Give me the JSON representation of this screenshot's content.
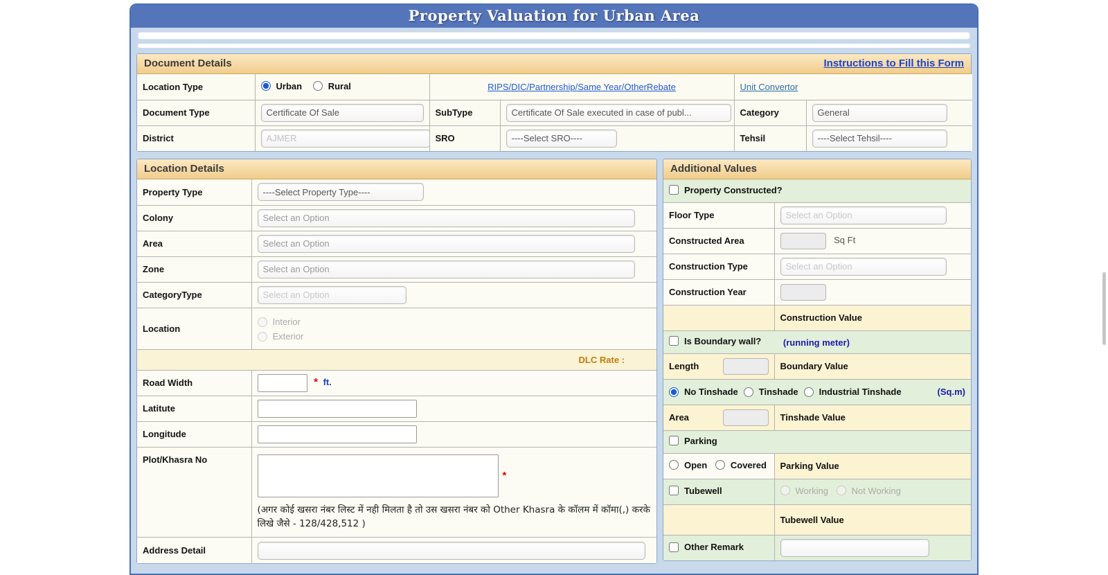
{
  "title": "Property Valuation for Urban Area",
  "colors": {
    "title_bar": "#5575bb",
    "section_header": "#f2cf8e",
    "green_row": "#e2efda",
    "cream_row": "#fbf3d2",
    "link_blue": "#1b46cf"
  },
  "document_details": {
    "header": "Document Details",
    "instructions_link": "Instructions to Fill this Form",
    "location_type_label": "Location Type",
    "urban_label": "Urban",
    "rural_label": "Rural",
    "rebate_link": "RIPS/DIC/Partnership/Same Year/OtherRebate",
    "unit_convertor_link": "Unit Convertor",
    "document_type_label": "Document Type",
    "document_type_value": "Certificate Of Sale",
    "subtype_label": "SubType",
    "subtype_value": "Certificate Of Sale executed in case of publ...",
    "category_label": "Category",
    "category_value": "General",
    "district_label": "District",
    "district_value": "AJMER",
    "sro_label": "SRO",
    "sro_value": "----Select SRO----",
    "tehsil_label": "Tehsil",
    "tehsil_value": "----Select Tehsil----"
  },
  "location_details": {
    "header": "Location Details",
    "property_type_label": "Property Type",
    "property_type_value": "----Select Property Type----",
    "colony_label": "Colony",
    "colony_placeholder": "Select an Option",
    "area_label": "Area",
    "area_placeholder": "Select an Option",
    "zone_label": "Zone",
    "zone_placeholder": "Select an Option",
    "categorytype_label": "CategoryType",
    "categorytype_placeholder": "Select an Option",
    "location_label": "Location",
    "interior_label": "Interior",
    "exterior_label": "Exterior",
    "dlc_rate_label": "DLC Rate :",
    "road_width_label": "Road Width",
    "required_marker": "*",
    "road_width_unit": "ft.",
    "latitude_label": "Latitute",
    "longitude_label": "Longitude",
    "plot_khasra_label": "Plot/Khasra No",
    "khasra_note": "(अगर कोई खसरा नंबर लिस्ट में नही मिलता है तो उस खसरा नंबर को Other Khasra के कॉलम में कॉमा(,) करके लिखे जैसे - 128/428,512 )",
    "address_detail_label": "Address Detail"
  },
  "additional_values": {
    "header": "Additional Values",
    "property_constructed_label": "Property Constructed?",
    "floor_type_label": "Floor Type",
    "floor_type_placeholder": "Select an Option",
    "constructed_area_label": "Constructed Area",
    "constructed_area_unit": "Sq Ft",
    "construction_type_label": "Construction Type",
    "construction_type_placeholder": "Select an Option",
    "construction_year_label": "Construction Year",
    "construction_value_label": "Construction Value",
    "boundary_wall_label": "Is Boundary wall?",
    "running_meter_note": "(running meter)",
    "length_label": "Length",
    "boundary_value_label": "Boundary Value",
    "no_tinshade_label": "No Tinshade",
    "tinshade_label": "Tinshade",
    "industrial_tinshade_label": "Industrial Tinshade",
    "sqm_note": "(Sq.m)",
    "tinshade_area_label": "Area",
    "tinshade_value_label": "Tinshade Value",
    "parking_label": "Parking",
    "open_label": "Open",
    "covered_label": "Covered",
    "parking_value_label": "Parking Value",
    "tubewell_label": "Tubewell",
    "working_label": "Working",
    "not_working_label": "Not Working",
    "tubewell_value_label": "Tubewell Value",
    "other_remark_label": "Other Remark"
  }
}
